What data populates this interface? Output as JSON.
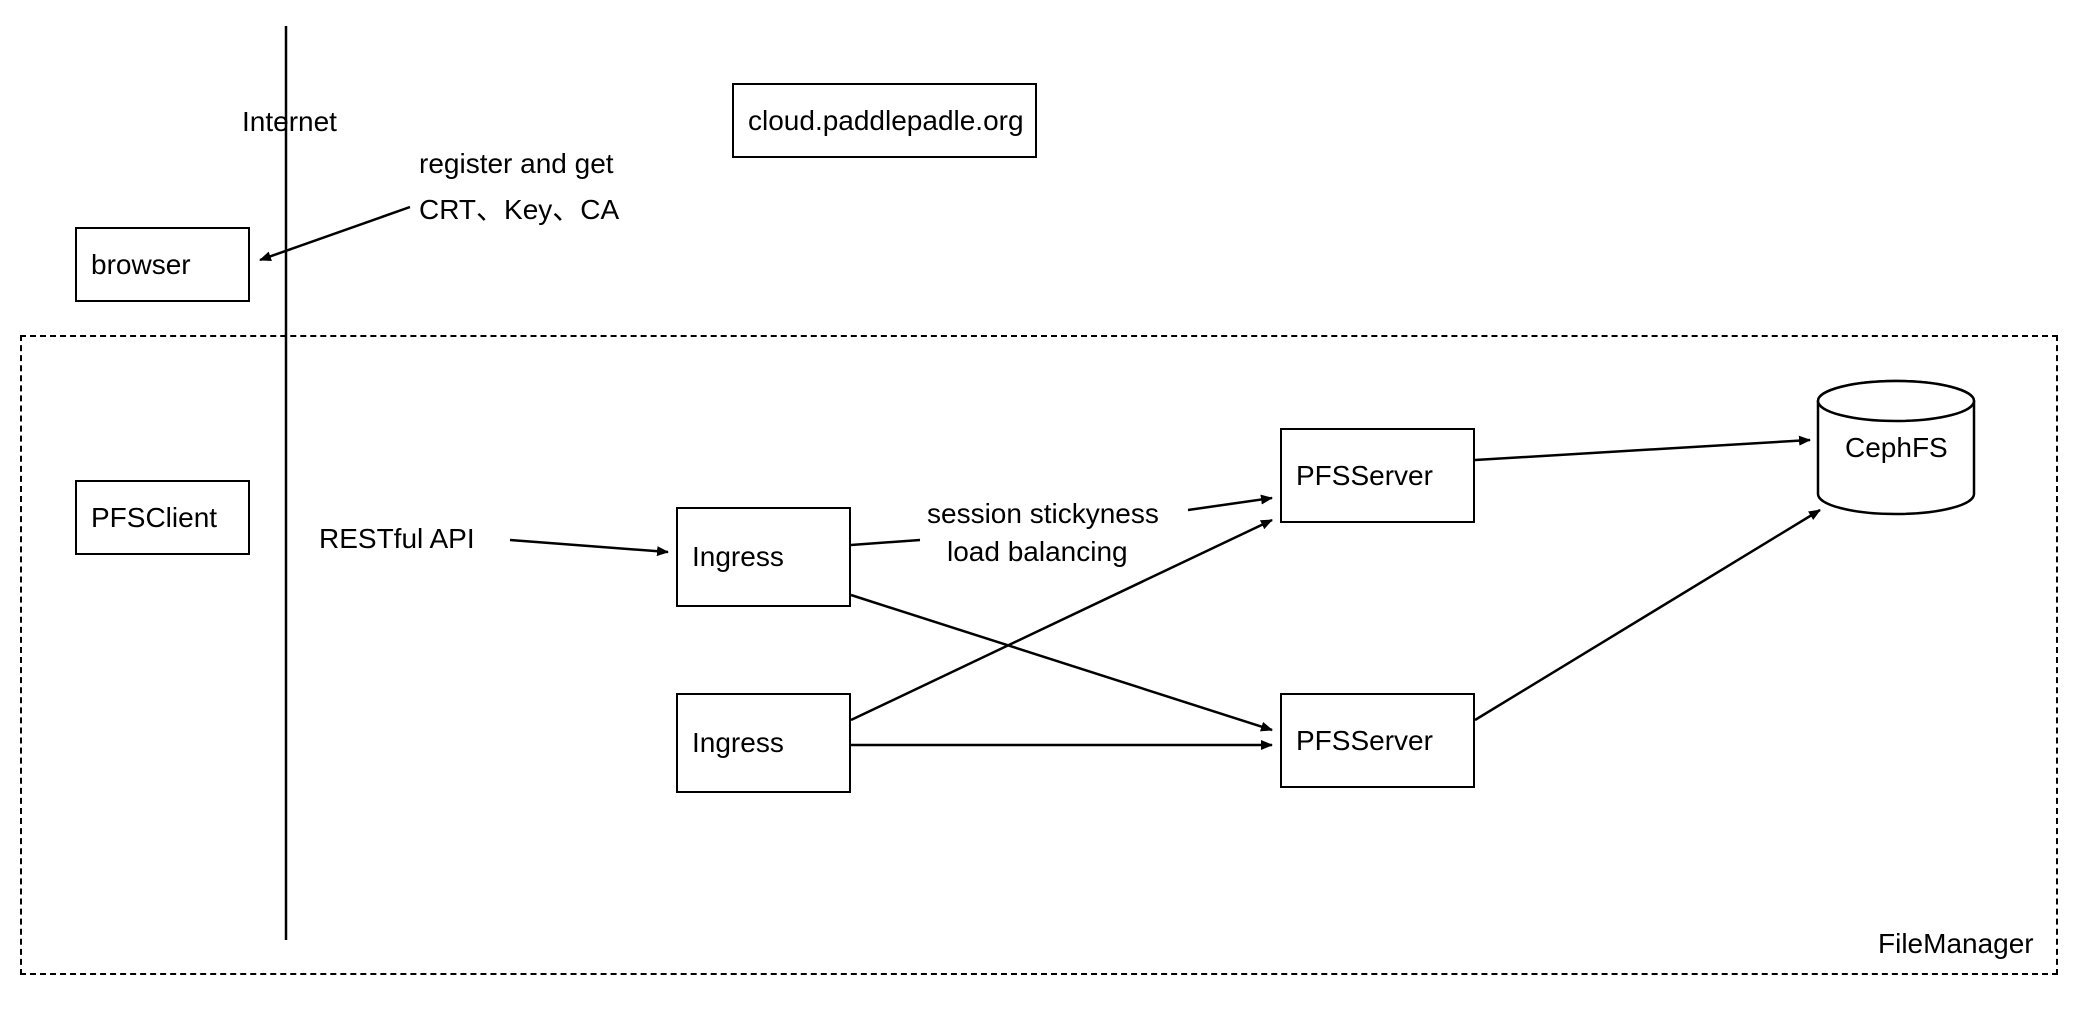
{
  "nodes": {
    "browser": "browser",
    "cloud": "cloud.paddlepadle.org",
    "pfsclient": "PFSClient",
    "ingress1": "Ingress",
    "ingress2": "Ingress",
    "pfsserver1": "PFSServer",
    "pfsserver2": "PFSServer",
    "cephfs": "CephFS"
  },
  "labels": {
    "internet": "Internet",
    "register1": "register and get",
    "register2": "CRT、Key、CA",
    "restful": "RESTful API",
    "session1": "session stickyness",
    "session2": "load balancing",
    "container": "FileManager"
  }
}
